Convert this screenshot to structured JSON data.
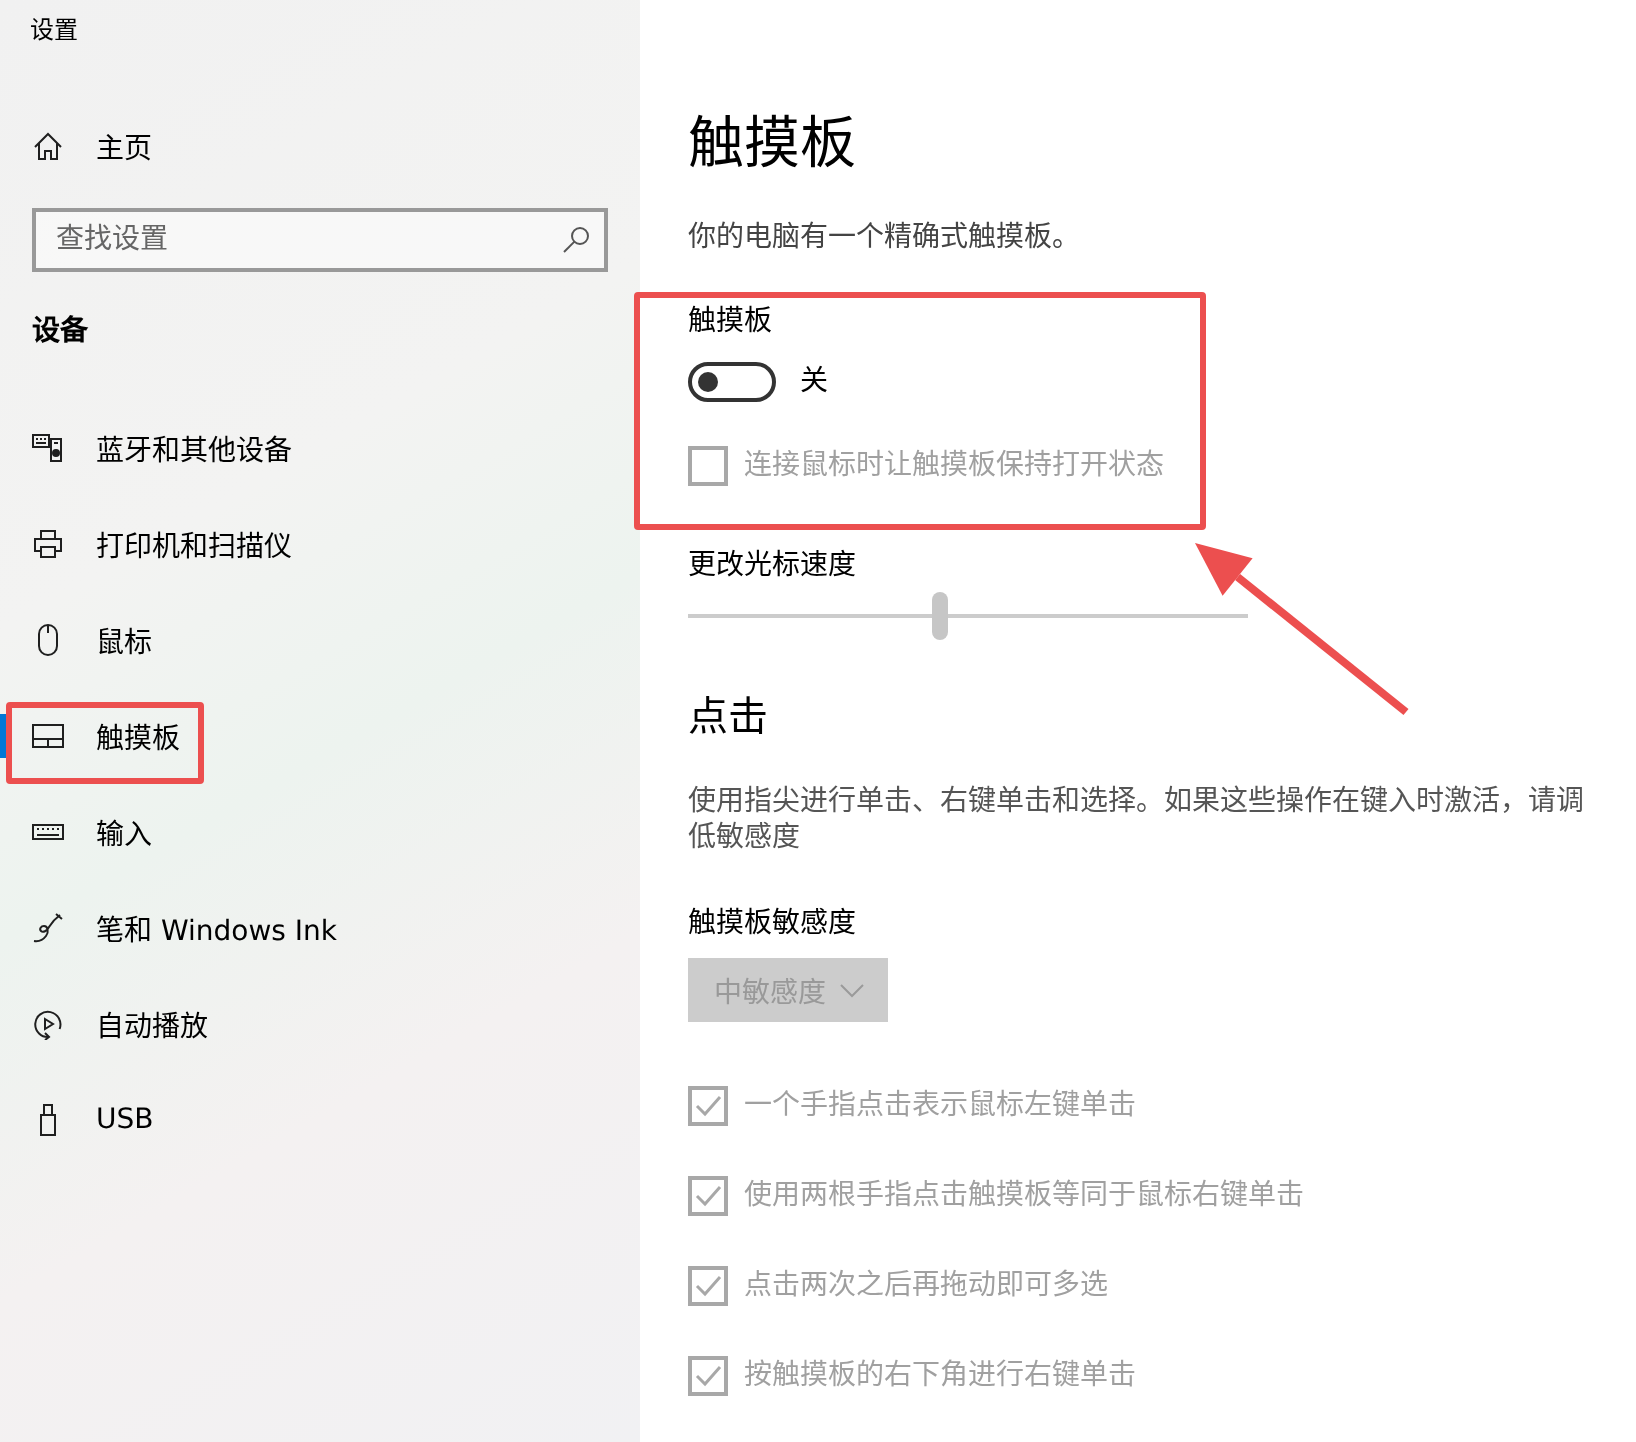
{
  "window": {
    "title": "设置"
  },
  "sidebar": {
    "home": {
      "label": "主页"
    },
    "search": {
      "placeholder": "查找设置"
    },
    "section_title": "设备",
    "items": [
      {
        "label": "蓝牙和其他设备",
        "selected": false,
        "annotated": false
      },
      {
        "label": "打印机和扫描仪",
        "selected": false,
        "annotated": false
      },
      {
        "label": "鼠标",
        "selected": false,
        "annotated": false
      },
      {
        "label": "触摸板",
        "selected": true,
        "annotated": true
      },
      {
        "label": "输入",
        "selected": false,
        "annotated": false
      },
      {
        "label": "笔和 Windows Ink",
        "selected": false,
        "annotated": false
      },
      {
        "label": "自动播放",
        "selected": false,
        "annotated": false
      },
      {
        "label": "USB",
        "selected": false,
        "annotated": false
      }
    ]
  },
  "content": {
    "title": "触摸板",
    "intro": "你的电脑有一个精确式触摸板。",
    "touchpad_group": {
      "annotated": true,
      "label": "触摸板",
      "toggle": {
        "on": false,
        "state_label": "关"
      },
      "keep_on_checkbox": {
        "label": "连接鼠标时让触摸板保持打开状态",
        "checked": false,
        "disabled": true
      }
    },
    "cursor_speed": {
      "label": "更改光标速度",
      "level": 0.45,
      "disabled": true
    },
    "taps": {
      "heading": "点击",
      "description": "使用指尖进行单击、右键单击和选择。如果这些操作在键入时激活，请调低敏感度",
      "sensitivity": {
        "label": "触摸板敏感度",
        "value": "中敏感度",
        "disabled": true
      },
      "options": [
        {
          "label": "一个手指点击表示鼠标左键单击",
          "checked": true,
          "disabled": true
        },
        {
          "label": "使用两根手指点击触摸板等同于鼠标右键单击",
          "checked": true,
          "disabled": true
        },
        {
          "label": "点击两次之后再拖动即可多选",
          "checked": true,
          "disabled": true
        },
        {
          "label": "按触摸板的右下角进行右键单击",
          "checked": true,
          "disabled": true
        }
      ]
    }
  }
}
